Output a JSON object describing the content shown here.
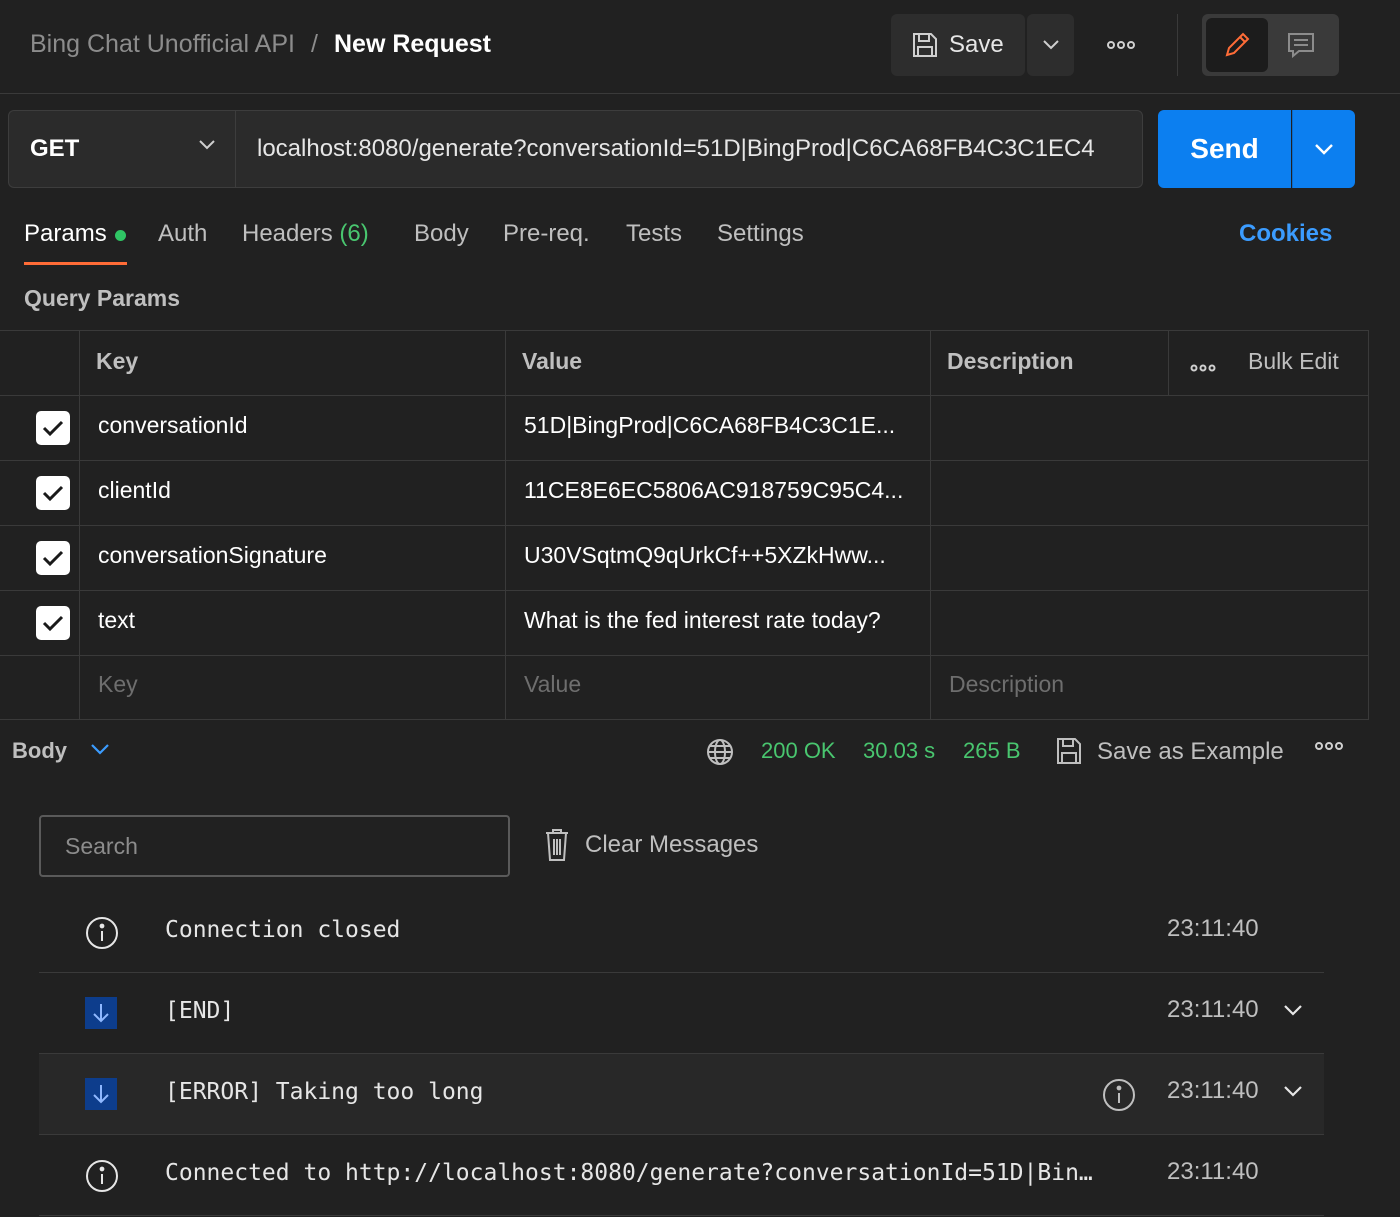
{
  "header": {
    "breadcrumb_parent": "Bing Chat Unofficial API",
    "breadcrumb_separator": "/",
    "breadcrumb_current": "New Request",
    "save_label": "Save"
  },
  "request": {
    "method": "GET",
    "url": "localhost:8080/generate?conversationId=51D|BingProd|C6CA68FB4C3C1EC4",
    "send_label": "Send"
  },
  "tabs": {
    "params": "Params",
    "auth": "Auth",
    "headers": "Headers",
    "headers_count": "(6)",
    "body": "Body",
    "prereq": "Pre-req.",
    "tests": "Tests",
    "settings": "Settings",
    "cookies": "Cookies"
  },
  "query_params": {
    "title": "Query Params",
    "columns": {
      "key": "Key",
      "value": "Value",
      "description": "Description",
      "bulk_edit": "Bulk Edit"
    },
    "rows": [
      {
        "key": "conversationId",
        "value": "51D|BingProd|C6CA68FB4C3C1E...",
        "checked": true
      },
      {
        "key": "clientId",
        "value": "11CE8E6EC5806AC918759C95C4...",
        "checked": true
      },
      {
        "key": "conversationSignature",
        "value": "U30VSqtmQ9qUrkCf++5XZkHww...",
        "checked": true
      },
      {
        "key": "text",
        "value": "What is the fed interest rate today?",
        "checked": true
      }
    ],
    "placeholders": {
      "key": "Key",
      "value": "Value",
      "description": "Description"
    }
  },
  "response": {
    "body_label": "Body",
    "status": "200 OK",
    "time": "30.03 s",
    "size": "265 B",
    "save_example": "Save as Example"
  },
  "messages": {
    "search_placeholder": "Search",
    "clear_label": "Clear Messages",
    "items": [
      {
        "text": "Connection closed",
        "time": "23:11:40",
        "icon": "info-icon"
      },
      {
        "text": "[END]",
        "time": "23:11:40",
        "icon": "arrow-down-icon"
      },
      {
        "text": "[ERROR] Taking too long",
        "time": "23:11:40",
        "icon": "arrow-down-icon"
      },
      {
        "text": "Connected to http://localhost:8080/generate?conversationId=51D|Bin…",
        "time": "23:11:40",
        "icon": "info-icon"
      }
    ]
  },
  "colors": {
    "accent_orange": "#ff6c37",
    "send_blue": "#0c7ff0",
    "status_green": "#49c66f",
    "link_blue": "#3b9cff"
  }
}
